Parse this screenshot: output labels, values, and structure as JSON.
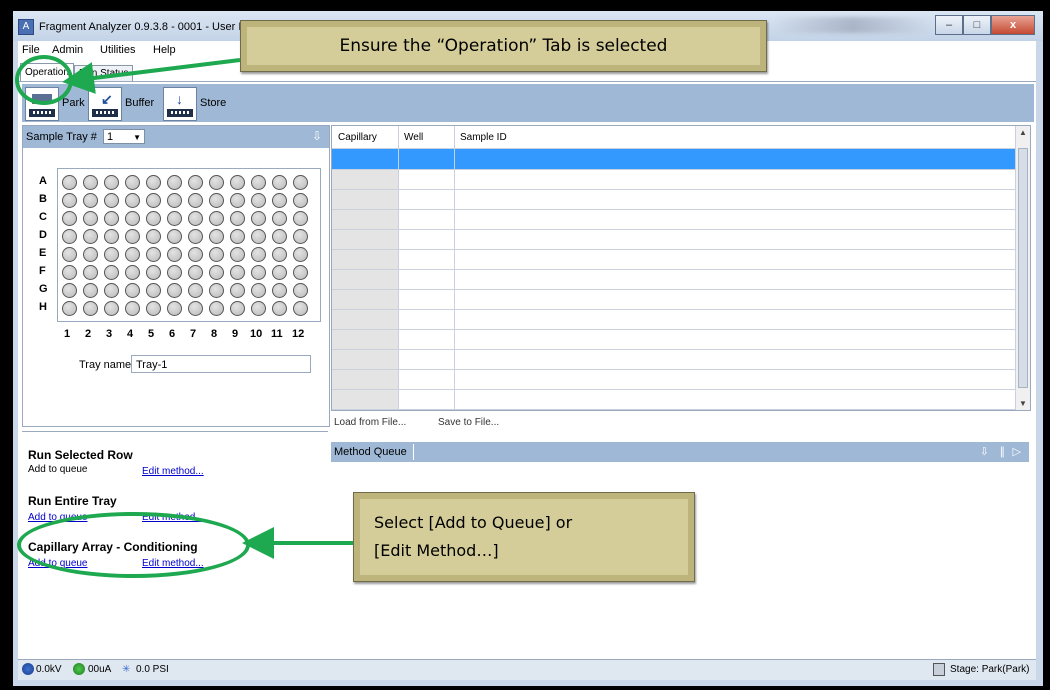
{
  "window": {
    "title": "Fragment Analyzer 0.9.3.8 - 0001 - User ID",
    "app_icon": "fragment-analyzer-icon",
    "minimize": "–",
    "maximize": "□",
    "close": "x"
  },
  "menu": [
    {
      "label": "File"
    },
    {
      "label": "Admin"
    },
    {
      "label": "Utilities"
    },
    {
      "label": "Help"
    }
  ],
  "tabs": [
    {
      "label": "Operation",
      "selected": true
    },
    {
      "label": "Run Status",
      "selected": false
    }
  ],
  "toolbar": {
    "park": "Park",
    "buffer": "Buffer",
    "store": "Store"
  },
  "sample_tray": {
    "label": "Sample Tray #",
    "selected": "1",
    "rows": [
      "A",
      "B",
      "C",
      "D",
      "E",
      "F",
      "G",
      "H"
    ],
    "cols": [
      "1",
      "2",
      "3",
      "4",
      "5",
      "6",
      "7",
      "8",
      "9",
      "10",
      "11",
      "12"
    ],
    "tray_name_label": "Tray name",
    "tray_name_value": "Tray-1"
  },
  "grid": {
    "headers": {
      "capillary": "Capillary",
      "well": "Well",
      "sample_id": "Sample ID"
    },
    "load": "Load from File...",
    "save": "Save to File..."
  },
  "methods": {
    "run_selected_row": {
      "title": "Run Selected Row",
      "add": "Add to queue",
      "edit": "Edit method..."
    },
    "run_entire_tray": {
      "title": "Run Entire Tray",
      "add": "Add to queue",
      "edit": "Edit method..."
    },
    "cap_conditioning": {
      "title": "Capillary Array - Conditioning",
      "add": "Add to queue",
      "edit": "Edit method..."
    }
  },
  "method_queue": {
    "label": "Method Queue"
  },
  "status": {
    "kv": "0.0kV",
    "ua": "00uA",
    "psi": "0.0 PSI",
    "stage": "Stage: Park(Park)"
  },
  "callouts": {
    "top": "Ensure the “Operation” Tab is selected",
    "bottom_line1": "Select [Add to Queue] or",
    "bottom_line2": "[Edit Method…]"
  },
  "colors": {
    "highlight": "#3399ff",
    "panel": "#9fb8d6",
    "annotation": "#1ea84f"
  }
}
